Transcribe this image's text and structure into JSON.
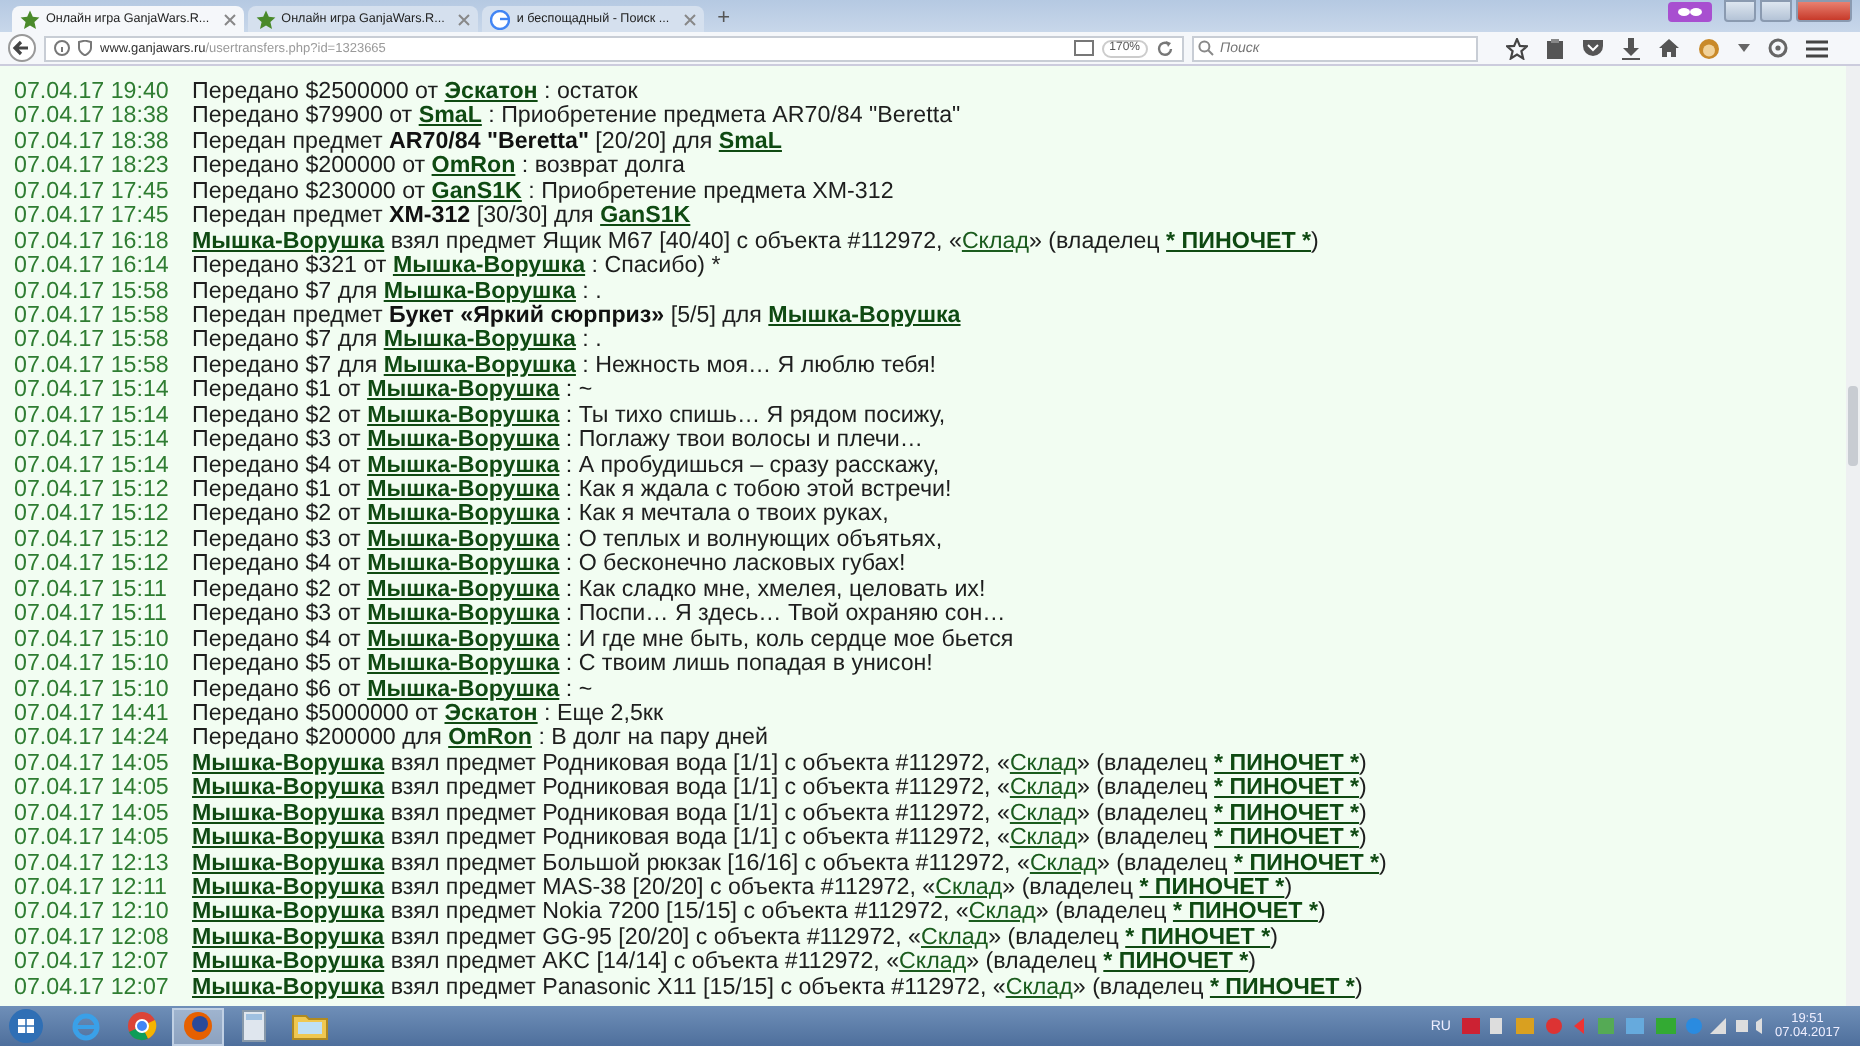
{
  "browser": {
    "tabs": [
      {
        "title": "Онлайн игра GanjaWars.R...",
        "kind": "game",
        "selected": true
      },
      {
        "title": "Онлайн игра GanjaWars.R...",
        "kind": "game",
        "selected": false
      },
      {
        "title": "и беспощадный - Поиск ...",
        "kind": "search",
        "selected": false
      }
    ],
    "new_tab": "+",
    "url_host": "www.ganjawars.ru",
    "url_path": "/usertransfers.php?id=1323665",
    "zoom": "170%",
    "search": {
      "placeholder": "Поиск"
    }
  },
  "transfers": [
    {
      "date": "07.04.17 19:40",
      "parts": [
        {
          "kind": "text",
          "text": "Передано $2500000 от "
        },
        {
          "kind": "link",
          "text": "Эскатон"
        },
        {
          "kind": "text",
          "text": " : остаток"
        }
      ]
    },
    {
      "date": "07.04.17 18:38",
      "parts": [
        {
          "kind": "text",
          "text": "Передано $79900 от "
        },
        {
          "kind": "link",
          "text": "SmaL"
        },
        {
          "kind": "text",
          "text": " : Приобретение предмета AR70/84 \"Beretta\""
        }
      ]
    },
    {
      "date": "07.04.17 18:38",
      "parts": [
        {
          "kind": "text",
          "text": "Передан предмет "
        },
        {
          "kind": "bold",
          "text": "AR70/84 \"Beretta\""
        },
        {
          "kind": "text",
          "text": " [20/20] для "
        },
        {
          "kind": "link",
          "text": "SmaL"
        }
      ]
    },
    {
      "date": "07.04.17 18:23",
      "parts": [
        {
          "kind": "text",
          "text": "Передано $200000 от "
        },
        {
          "kind": "link",
          "text": "OmRon"
        },
        {
          "kind": "text",
          "text": " : возврат долга"
        }
      ]
    },
    {
      "date": "07.04.17 17:45",
      "parts": [
        {
          "kind": "text",
          "text": "Передано $230000 от "
        },
        {
          "kind": "link",
          "text": "GanS1K"
        },
        {
          "kind": "text",
          "text": " : Приобретение предмета XM-312"
        }
      ]
    },
    {
      "date": "07.04.17 17:45",
      "parts": [
        {
          "kind": "text",
          "text": "Передан предмет "
        },
        {
          "kind": "bold",
          "text": "XM-312"
        },
        {
          "kind": "text",
          "text": " [30/30] для "
        },
        {
          "kind": "link",
          "text": "GanS1K"
        }
      ]
    },
    {
      "date": "07.04.17 16:18",
      "parts": [
        {
          "kind": "link",
          "text": "Мышка-Ворушка"
        },
        {
          "kind": "text",
          "text": " взял предмет Ящик M67 [40/40] с объекта #112972, «"
        },
        {
          "kind": "plain_link",
          "text": "Склад"
        },
        {
          "kind": "text",
          "text": "» (владелец "
        },
        {
          "kind": "link",
          "text": "* ПИНОЧЕТ *"
        },
        {
          "kind": "text",
          "text": ")"
        }
      ]
    },
    {
      "date": "07.04.17 16:14",
      "parts": [
        {
          "kind": "text",
          "text": "Передано $321 от "
        },
        {
          "kind": "link",
          "text": "Мышка-Ворушка"
        },
        {
          "kind": "text",
          "text": " : Спасибо) *"
        }
      ]
    },
    {
      "date": "07.04.17 15:58",
      "parts": [
        {
          "kind": "text",
          "text": "Передано $7 для "
        },
        {
          "kind": "link",
          "text": "Мышка-Ворушка"
        },
        {
          "kind": "text",
          "text": " : ."
        }
      ]
    },
    {
      "date": "07.04.17 15:58",
      "parts": [
        {
          "kind": "text",
          "text": "Передан предмет "
        },
        {
          "kind": "bold",
          "text": "Букет «Яркий сюрприз»"
        },
        {
          "kind": "text",
          "text": " [5/5] для "
        },
        {
          "kind": "link",
          "text": "Мышка-Ворушка"
        }
      ]
    },
    {
      "date": "07.04.17 15:58",
      "parts": [
        {
          "kind": "text",
          "text": "Передано $7 для "
        },
        {
          "kind": "link",
          "text": "Мышка-Ворушка"
        },
        {
          "kind": "text",
          "text": " : ."
        }
      ]
    },
    {
      "date": "07.04.17 15:58",
      "parts": [
        {
          "kind": "text",
          "text": "Передано $7 для "
        },
        {
          "kind": "link",
          "text": "Мышка-Ворушка"
        },
        {
          "kind": "text",
          "text": " : Нежность моя… Я люблю тебя!"
        }
      ]
    },
    {
      "date": "07.04.17 15:14",
      "parts": [
        {
          "kind": "text",
          "text": "Передано $1 от "
        },
        {
          "kind": "link",
          "text": "Мышка-Ворушка"
        },
        {
          "kind": "text",
          "text": " : ~"
        }
      ]
    },
    {
      "date": "07.04.17 15:14",
      "parts": [
        {
          "kind": "text",
          "text": "Передано $2 от "
        },
        {
          "kind": "link",
          "text": "Мышка-Ворушка"
        },
        {
          "kind": "text",
          "text": " : Ты тихо спишь… Я рядом посижу,"
        }
      ]
    },
    {
      "date": "07.04.17 15:14",
      "parts": [
        {
          "kind": "text",
          "text": "Передано $3 от "
        },
        {
          "kind": "link",
          "text": "Мышка-Ворушка"
        },
        {
          "kind": "text",
          "text": " : Поглажу твои волосы и плечи…"
        }
      ]
    },
    {
      "date": "07.04.17 15:14",
      "parts": [
        {
          "kind": "text",
          "text": "Передано $4 от "
        },
        {
          "kind": "link",
          "text": "Мышка-Ворушка"
        },
        {
          "kind": "text",
          "text": " : А пробудишься – сразу расскажу,"
        }
      ]
    },
    {
      "date": "07.04.17 15:12",
      "parts": [
        {
          "kind": "text",
          "text": "Передано $1 от "
        },
        {
          "kind": "link",
          "text": "Мышка-Ворушка"
        },
        {
          "kind": "text",
          "text": " : Как я ждала с тобою этой встречи!"
        }
      ]
    },
    {
      "date": "07.04.17 15:12",
      "parts": [
        {
          "kind": "text",
          "text": "Передано $2 от "
        },
        {
          "kind": "link",
          "text": "Мышка-Ворушка"
        },
        {
          "kind": "text",
          "text": " : Как я мечтала о твоих руках,"
        }
      ]
    },
    {
      "date": "07.04.17 15:12",
      "parts": [
        {
          "kind": "text",
          "text": "Передано $3 от "
        },
        {
          "kind": "link",
          "text": "Мышка-Ворушка"
        },
        {
          "kind": "text",
          "text": " : О теплых и волнующих объятьях,"
        }
      ]
    },
    {
      "date": "07.04.17 15:12",
      "parts": [
        {
          "kind": "text",
          "text": "Передано $4 от "
        },
        {
          "kind": "link",
          "text": "Мышка-Ворушка"
        },
        {
          "kind": "text",
          "text": " : О бесконечно ласковых губах!"
        }
      ]
    },
    {
      "date": "07.04.17 15:11",
      "parts": [
        {
          "kind": "text",
          "text": "Передано $2 от "
        },
        {
          "kind": "link",
          "text": "Мышка-Ворушка"
        },
        {
          "kind": "text",
          "text": " : Как сладко мне, хмелея, целовать их!"
        }
      ]
    },
    {
      "date": "07.04.17 15:11",
      "parts": [
        {
          "kind": "text",
          "text": "Передано $3 от "
        },
        {
          "kind": "link",
          "text": "Мышка-Ворушка"
        },
        {
          "kind": "text",
          "text": " : Поспи… Я здесь… Твой охраняю сон…"
        }
      ]
    },
    {
      "date": "07.04.17 15:10",
      "parts": [
        {
          "kind": "text",
          "text": "Передано $4 от "
        },
        {
          "kind": "link",
          "text": "Мышка-Ворушка"
        },
        {
          "kind": "text",
          "text": " : И где мне быть, коль сердце мое бьется"
        }
      ]
    },
    {
      "date": "07.04.17 15:10",
      "parts": [
        {
          "kind": "text",
          "text": "Передано $5 от "
        },
        {
          "kind": "link",
          "text": "Мышка-Ворушка"
        },
        {
          "kind": "text",
          "text": " : С твоим лишь попадая в унисон!"
        }
      ]
    },
    {
      "date": "07.04.17 15:10",
      "parts": [
        {
          "kind": "text",
          "text": "Передано $6 от "
        },
        {
          "kind": "link",
          "text": "Мышка-Ворушка"
        },
        {
          "kind": "text",
          "text": " : ~"
        }
      ]
    },
    {
      "date": "07.04.17 14:41",
      "parts": [
        {
          "kind": "text",
          "text": "Передано $5000000 от "
        },
        {
          "kind": "link",
          "text": "Эскатон"
        },
        {
          "kind": "text",
          "text": " : Еще 2,5кк"
        }
      ]
    },
    {
      "date": "07.04.17 14:24",
      "parts": [
        {
          "kind": "text",
          "text": "Передано $200000 для "
        },
        {
          "kind": "link",
          "text": "OmRon"
        },
        {
          "kind": "text",
          "text": " : В долг на пару дней"
        }
      ]
    },
    {
      "date": "07.04.17 14:05",
      "parts": [
        {
          "kind": "link",
          "text": "Мышка-Ворушка"
        },
        {
          "kind": "text",
          "text": " взял предмет Родниковая вода [1/1] с объекта #112972, «"
        },
        {
          "kind": "plain_link",
          "text": "Склад"
        },
        {
          "kind": "text",
          "text": "» (владелец "
        },
        {
          "kind": "link",
          "text": "* ПИНОЧЕТ *"
        },
        {
          "kind": "text",
          "text": ")"
        }
      ]
    },
    {
      "date": "07.04.17 14:05",
      "parts": [
        {
          "kind": "link",
          "text": "Мышка-Ворушка"
        },
        {
          "kind": "text",
          "text": " взял предмет Родниковая вода [1/1] с объекта #112972, «"
        },
        {
          "kind": "plain_link",
          "text": "Склад"
        },
        {
          "kind": "text",
          "text": "» (владелец "
        },
        {
          "kind": "link",
          "text": "* ПИНОЧЕТ *"
        },
        {
          "kind": "text",
          "text": ")"
        }
      ]
    },
    {
      "date": "07.04.17 14:05",
      "parts": [
        {
          "kind": "link",
          "text": "Мышка-Ворушка"
        },
        {
          "kind": "text",
          "text": " взял предмет Родниковая вода [1/1] с объекта #112972, «"
        },
        {
          "kind": "plain_link",
          "text": "Склад"
        },
        {
          "kind": "text",
          "text": "» (владелец "
        },
        {
          "kind": "link",
          "text": "* ПИНОЧЕТ *"
        },
        {
          "kind": "text",
          "text": ")"
        }
      ]
    },
    {
      "date": "07.04.17 14:05",
      "parts": [
        {
          "kind": "link",
          "text": "Мышка-Ворушка"
        },
        {
          "kind": "text",
          "text": " взял предмет Родниковая вода [1/1] с объекта #112972, «"
        },
        {
          "kind": "plain_link",
          "text": "Склад"
        },
        {
          "kind": "text",
          "text": "» (владелец "
        },
        {
          "kind": "link",
          "text": "* ПИНОЧЕТ *"
        },
        {
          "kind": "text",
          "text": ")"
        }
      ]
    },
    {
      "date": "07.04.17 12:13",
      "parts": [
        {
          "kind": "link",
          "text": "Мышка-Ворушка"
        },
        {
          "kind": "text",
          "text": " взял предмет Большой рюкзак [16/16] с объекта #112972, «"
        },
        {
          "kind": "plain_link",
          "text": "Склад"
        },
        {
          "kind": "text",
          "text": "» (владелец "
        },
        {
          "kind": "link",
          "text": "* ПИНОЧЕТ *"
        },
        {
          "kind": "text",
          "text": ")"
        }
      ]
    },
    {
      "date": "07.04.17 12:11",
      "parts": [
        {
          "kind": "link",
          "text": "Мышка-Ворушка"
        },
        {
          "kind": "text",
          "text": " взял предмет MAS-38 [20/20] с объекта #112972, «"
        },
        {
          "kind": "plain_link",
          "text": "Склад"
        },
        {
          "kind": "text",
          "text": "» (владелец "
        },
        {
          "kind": "link",
          "text": "* ПИНОЧЕТ *"
        },
        {
          "kind": "text",
          "text": ")"
        }
      ]
    },
    {
      "date": "07.04.17 12:10",
      "parts": [
        {
          "kind": "link",
          "text": "Мышка-Ворушка"
        },
        {
          "kind": "text",
          "text": " взял предмет Nokia 7200 [15/15] с объекта #112972, «"
        },
        {
          "kind": "plain_link",
          "text": "Склад"
        },
        {
          "kind": "text",
          "text": "» (владелец "
        },
        {
          "kind": "link",
          "text": "* ПИНОЧЕТ *"
        },
        {
          "kind": "text",
          "text": ")"
        }
      ]
    },
    {
      "date": "07.04.17 12:08",
      "parts": [
        {
          "kind": "link",
          "text": "Мышка-Ворушка"
        },
        {
          "kind": "text",
          "text": " взял предмет GG-95 [20/20] с объекта #112972, «"
        },
        {
          "kind": "plain_link",
          "text": "Склад"
        },
        {
          "kind": "text",
          "text": "» (владелец "
        },
        {
          "kind": "link",
          "text": "* ПИНОЧЕТ *"
        },
        {
          "kind": "text",
          "text": ")"
        }
      ]
    },
    {
      "date": "07.04.17 12:07",
      "parts": [
        {
          "kind": "link",
          "text": "Мышка-Ворушка"
        },
        {
          "kind": "text",
          "text": " взял предмет AKC [14/14] с объекта #112972, «"
        },
        {
          "kind": "plain_link",
          "text": "Склад"
        },
        {
          "kind": "text",
          "text": "» (владелец "
        },
        {
          "kind": "link",
          "text": "* ПИНОЧЕТ *"
        },
        {
          "kind": "text",
          "text": ")"
        }
      ]
    },
    {
      "date": "07.04.17 12:07",
      "parts": [
        {
          "kind": "link",
          "text": "Мышка-Ворушка"
        },
        {
          "kind": "text",
          "text": " взял предмет Panasonic X11 [15/15] с объекта #112972, «"
        },
        {
          "kind": "plain_link",
          "text": "Склад"
        },
        {
          "kind": "text",
          "text": "» (владелец "
        },
        {
          "kind": "link",
          "text": "* ПИНОЧЕТ *"
        },
        {
          "kind": "text",
          "text": ")"
        }
      ]
    }
  ],
  "taskbar": {
    "apps": [
      {
        "kind": "ie",
        "selected": false
      },
      {
        "kind": "chrome",
        "selected": false
      },
      {
        "kind": "firefox",
        "selected": true
      },
      {
        "kind": "calculator",
        "selected": false
      },
      {
        "kind": "folder",
        "selected": false
      }
    ],
    "language": "RU",
    "time": "19:51",
    "date": "07.04.2017"
  }
}
